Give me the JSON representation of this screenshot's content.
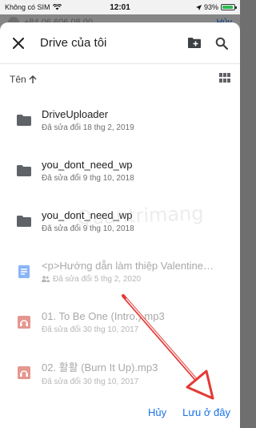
{
  "status_bar": {
    "carrier": "Không có SIM",
    "time": "12:01",
    "battery_text": "93%",
    "battery_level": 0.93
  },
  "background": {
    "peek_text": "+84 06 606 08 00",
    "cancel_label": "Hủy"
  },
  "header": {
    "title": "Drive của tôi",
    "close_icon": "close-icon",
    "new_folder_icon": "new-folder-icon",
    "search_icon": "search-icon"
  },
  "sort": {
    "label": "Tên",
    "direction_icon": "arrow-up-icon",
    "view_icon": "grid-view-icon"
  },
  "items": [
    {
      "name": "DriveUploader",
      "meta": "Đã sửa đổi 18 thg 2, 2019",
      "type": "folder",
      "disabled": false
    },
    {
      "name": "you_dont_need_wp",
      "meta": "Đã sửa đổi 9 thg 10, 2018",
      "type": "folder",
      "disabled": false
    },
    {
      "name": "you_dont_need_wp",
      "meta": "Đã sửa đổi 9 thg 10, 2018",
      "type": "folder",
      "disabled": false
    },
    {
      "name": "<p>Hướng dẫn làm thiệp Valentine…",
      "meta": "Đã sửa đổi 5 thg 2, 2020",
      "type": "doc",
      "disabled": true
    },
    {
      "name": "01. To Be One (Intro.).mp3",
      "meta": "Đã sửa đổi 30 thg 10, 2017",
      "type": "audio",
      "disabled": true
    },
    {
      "name": "02. 활활 (Burn It Up).mp3",
      "meta": "Đã sửa đổi 30 thg 10, 2017",
      "type": "audio",
      "disabled": true
    }
  ],
  "footer": {
    "cancel_label": "Hủy",
    "save_label": "Lưu ở đây"
  },
  "watermark": "Quantrimang",
  "colors": {
    "accent": "#1a73e8",
    "folder": "#5f6368",
    "doc": "#8ab4f8",
    "audio": "#e5978f",
    "arrow": "#e53935"
  }
}
